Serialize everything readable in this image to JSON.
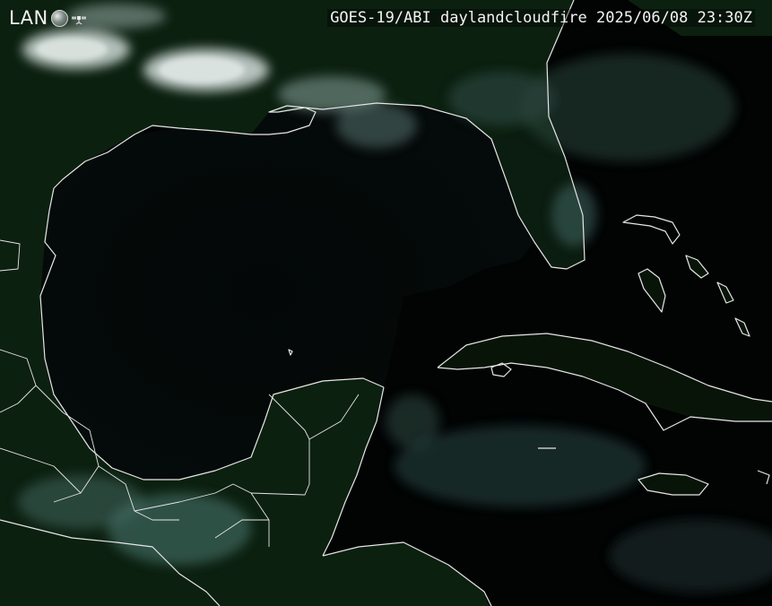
{
  "logo": {
    "text": "LAN",
    "icons": [
      "globe-icon",
      "satellite-icon"
    ]
  },
  "title": "GOES-19/ABI daylandcloudfire 2025/06/08 23:30Z",
  "colors": {
    "ocean": "#020404",
    "land": "#0d2211",
    "land_dark": "#07130a",
    "cloud": "#c9d6d2",
    "cloud_teal": "#5f8f88",
    "coastline": "#e8e8e8"
  }
}
